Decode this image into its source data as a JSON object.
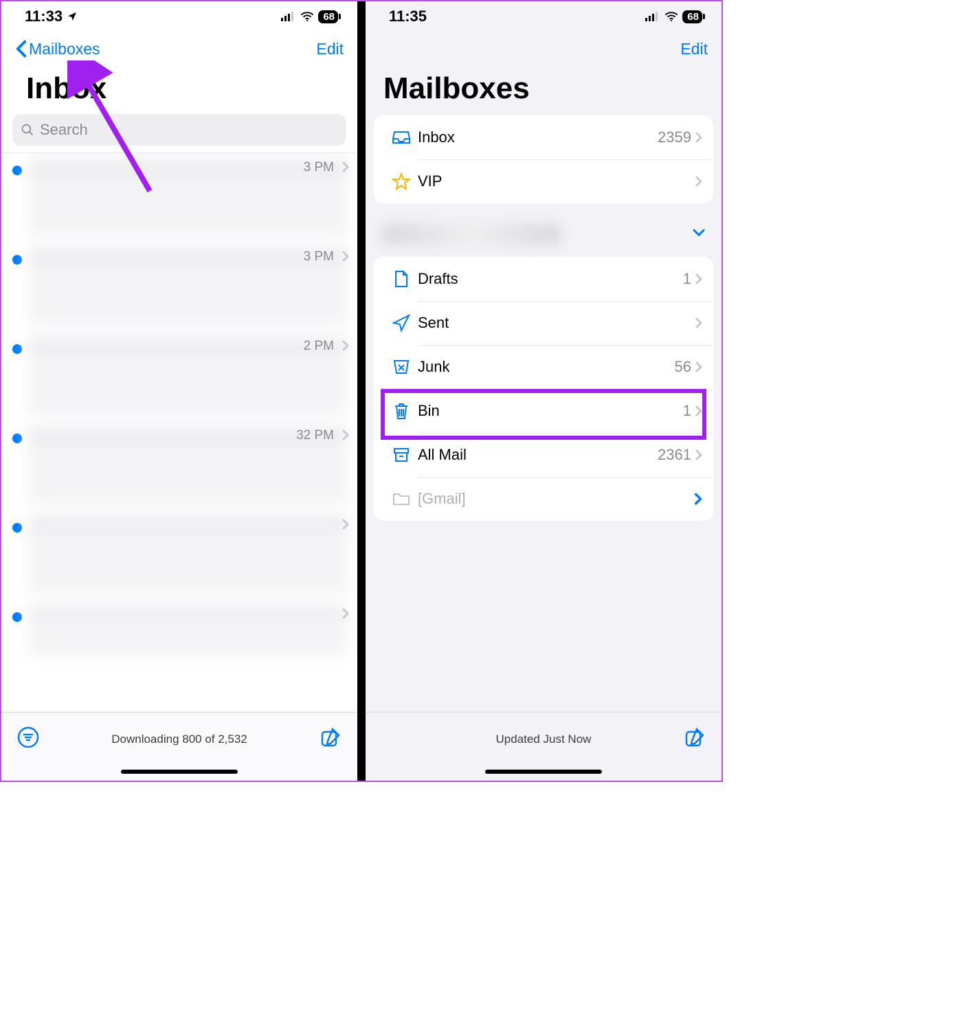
{
  "left": {
    "status": {
      "time": "11:33",
      "battery": "68"
    },
    "nav": {
      "back": "Mailboxes",
      "edit": "Edit"
    },
    "title": "Inbox",
    "search_placeholder": "Search",
    "messages": [
      {
        "time": "3 PM"
      },
      {
        "time": "3 PM"
      },
      {
        "time": "2 PM"
      },
      {
        "time": "32 PM"
      },
      {
        "time": ""
      },
      {
        "time": ""
      }
    ],
    "toolbar_status": "Downloading 800 of 2,532"
  },
  "right": {
    "status": {
      "time": "11:35",
      "battery": "68"
    },
    "nav": {
      "edit": "Edit"
    },
    "title": "Mailboxes",
    "primary": [
      {
        "icon": "inbox",
        "label": "Inbox",
        "count": "2359"
      },
      {
        "icon": "star",
        "label": "VIP",
        "count": ""
      }
    ],
    "account": [
      {
        "icon": "drafts",
        "label": "Drafts",
        "count": "1"
      },
      {
        "icon": "sent",
        "label": "Sent",
        "count": ""
      },
      {
        "icon": "junk",
        "label": "Junk",
        "count": "56"
      },
      {
        "icon": "bin",
        "label": "Bin",
        "count": "1"
      },
      {
        "icon": "allmail",
        "label": "All Mail",
        "count": "2361"
      },
      {
        "icon": "folder",
        "label": "[Gmail]",
        "count": ""
      }
    ],
    "toolbar_status": "Updated Just Now"
  }
}
